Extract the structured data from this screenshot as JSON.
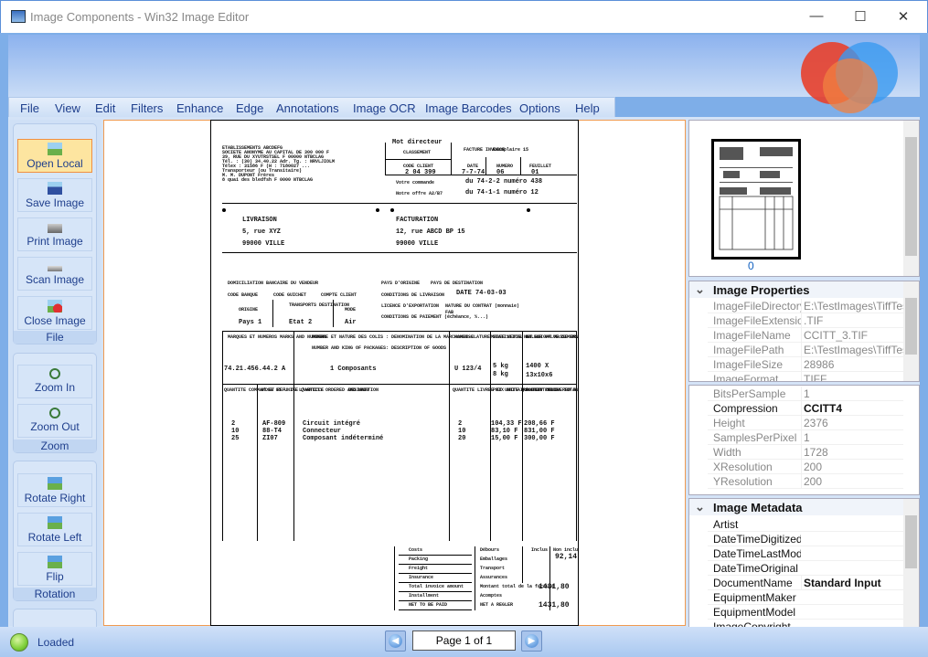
{
  "window": {
    "title": "Image Components - Win32 Image Editor",
    "minimize": "—",
    "maximize": "☐",
    "close": "✕"
  },
  "menu": [
    "File",
    "View",
    "Edit",
    "Filters",
    "Enhance",
    "Edge",
    "Annotations",
    "Image OCR",
    "Image Barcodes",
    "Options",
    "Help"
  ],
  "toolbar": {
    "file_group": {
      "title": "File",
      "buttons": [
        "Open Local",
        "Save Image",
        "Print Image",
        "Scan Image",
        "Close Image"
      ]
    },
    "zoom_group": {
      "title": "Zoom",
      "buttons": [
        "Zoom In",
        "Zoom Out"
      ]
    },
    "rotation_group": {
      "title": "Rotation",
      "buttons": [
        "Rotate Right",
        "Rotate Left",
        "Flip"
      ]
    }
  },
  "document": {
    "sender": [
      "ETABLISSEMENTS ABCDEFG",
      "SOCIETE ANONYME AU CAPITAL DE 300 000 F",
      "39, RUE DU XYUTRSTSEL F 00000 NTBCLAG",
      "Tél. : (30) 34.40.22 Adr. Tg. : NRVLJIOLM",
      "Télex : 31586 F (H : 7180027 ...",
      "Transporteur (ou Transitaire)",
      "M. M. DUPONT Frères",
      "8 quai des bledfsh F 0000 NTBCLAG"
    ],
    "mot_directeur": "Mot directeur",
    "classement": "CLASSEMENT",
    "code_client": "CODE CLIENT",
    "code_client_value": "2 04 399",
    "facture": "FACTURE INVOICE",
    "exemplaire": "Exemplaire 15",
    "date_label": "DATE",
    "date_value": "7-7-74",
    "numero_label": "NUMERO",
    "numero_value": "06",
    "feuillet_label": "FEUILLET",
    "feuillet_value": "01",
    "votre_commande": "Votre commande",
    "votre_commande_value": "du 74-2-2 numéro 438",
    "notre_offre": "Notre offre A2/B7",
    "notre_offre_value": "du 74-1-1 numéro 12",
    "livraison": [
      "LIVRAISON",
      "5, rue XYZ",
      "99000 VILLE"
    ],
    "facturation": [
      "FACTURATION",
      "12, rue ABCD BP 15",
      "99000 VILLE"
    ],
    "domiciliation": "DOMICILIATION BANCAIRE DU VENDEUR",
    "code_banque": "CODE BANQUE",
    "code_guichet": "CODE GUICHET",
    "compte_client": "COMPTE CLIENT",
    "pays_origine": "PAYS D'ORIGINE",
    "pays_destination": "PAYS DE DESTINATION",
    "conditions_livraison": "CONDITIONS DE LIVRAISON",
    "conditions_date": "DATE 74-03-03",
    "licence": "LICENCE D'EXPORTATION",
    "nature_contrat": "NATURE DU CONTRAT (monnaie)",
    "conditions_paiement": "CONDITIONS DE PAIEMENT (échéance, %...)",
    "fab": "FAB",
    "origine": "ORIGINE",
    "origine_value": "Pays 1",
    "transports": "TRANSPORTS DESTINATION",
    "transports_value": "Etat 2",
    "mode": "MODE",
    "mode_value": "Air",
    "marques": "MARQUES ET NUMEROS MARKS AND NUMBERS",
    "marques_value": "74.21.456.44.2 A",
    "nombre": "NOMBRE ET NATURE DES COLIS : DENOMINATION DE LA MARCHANDISE",
    "number_kind": "NUMBER AND KING OF PACKAGES: DESCRIPTION OF GOODS",
    "nombre_value": "1 Composants",
    "nomenclature": "NOMEN-CLATURE STATISTICAL No.",
    "nomenclature_value": "U 123/4",
    "masse": "MASSE NETTE NET WEIGHT MASSE BRUTE GROSS WEIGHT",
    "masse_value": [
      "5 kg",
      "8 kg"
    ],
    "valeur": "VALEUR VALUE DIMENSIONS MEASURE-MENTS",
    "valeur_value": [
      "1400 X",
      "13x10x6"
    ],
    "col_headers": [
      "QUANTITE COMMANDEE ET UNITE QUANTITY ORDERED AND UNIT",
      "N° ET REF. DE L'ARTICLE",
      "DESIGNATION",
      "QUANTITE LIVREE ET UNITE QUANTITY DELIVERED AND UNIT",
      "PRIX UNITAIRE UNIT PRICE",
      "MONTANT TOTAL TOTAL AMOUNT"
    ],
    "lines": [
      [
        "2",
        "AF-809",
        "Circuit intégré",
        "2",
        "104,33 F",
        "208,66 F"
      ],
      [
        "10",
        "88-T4",
        "Connecteur",
        "10",
        "83,10 F",
        "831,00 F"
      ],
      [
        "25",
        "ZI07",
        "Composant indéterminé",
        "20",
        "15,00 F",
        "300,00 F"
      ]
    ],
    "totals_left": [
      "Costs",
      "Packing",
      "Freight",
      "Insurance",
      "Total invoice amount",
      "Installment",
      "NET TO BE PAID"
    ],
    "totals_right": [
      "Débours",
      "Emballages",
      "Transport",
      "Assurances",
      "Montant total de la facture",
      "Acomptes",
      "NET A REGLER"
    ],
    "inclus": "Inclus",
    "non_inclus": "Non inclus",
    "non_inclus_value": "92,14",
    "total": "1431,80",
    "net": "1431,80"
  },
  "thumbnail": {
    "index": "0"
  },
  "properties": {
    "title": "Image Properties",
    "rows": [
      [
        "ImageFileDirectory",
        "E:\\TestImages\\TiffTest\\"
      ],
      [
        "ImageFileExtension",
        ".TIF"
      ],
      [
        "ImageFileName",
        "CCITT_3.TIF"
      ],
      [
        "ImageFilePath",
        "E:\\TestImages\\TiffTest\\"
      ],
      [
        "ImageFileSize",
        "28986"
      ],
      [
        "ImageFormat",
        "TIFF"
      ]
    ]
  },
  "details": {
    "rows": [
      [
        "BitsPerSample",
        "1"
      ],
      [
        "Compression",
        "CCITT4"
      ],
      [
        "Height",
        "2376"
      ],
      [
        "SamplesPerPixel",
        "1"
      ],
      [
        "Width",
        "1728"
      ],
      [
        "XResolution",
        "200"
      ],
      [
        "YResolution",
        "200"
      ]
    ]
  },
  "metadata": {
    "title": "Image Metadata",
    "rows": [
      [
        "Artist",
        ""
      ],
      [
        "DateTimeDigitized",
        ""
      ],
      [
        "DateTimeLastModif",
        ""
      ],
      [
        "DateTimeOriginal",
        ""
      ],
      [
        "DocumentName",
        "Standard Input"
      ],
      [
        "EquipmentMaker",
        ""
      ],
      [
        "EquipmentModel",
        ""
      ],
      [
        "ImageCopyright",
        ""
      ]
    ]
  },
  "status": {
    "text": "Loaded",
    "page": "Page 1 of 1",
    "indicator_color": "#7fd03a"
  },
  "colors": {
    "accent": "#1e3e8c",
    "selected": "#fde5a0",
    "frame": "#7eaee8"
  }
}
